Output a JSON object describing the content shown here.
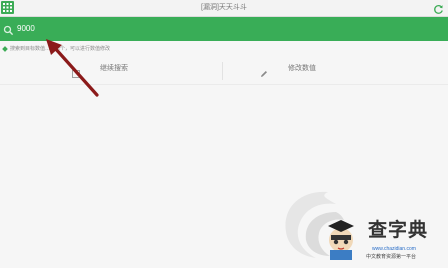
{
  "window": {
    "title": "[漏洞]天天斗斗"
  },
  "search": {
    "value": "9000"
  },
  "hint": {
    "text": "搜索到目标数值…目标个，可以进行数值修改"
  },
  "actions": {
    "continue_label": "继续搜索",
    "modify_label": "修改数值"
  },
  "watermark": {
    "logo_text": "查字典",
    "url": "www.chazidian.com",
    "tagline": "中文教育资源第一平台"
  },
  "colors": {
    "accent": "#39ad57",
    "annotation_arrow": "#8b1a1a"
  },
  "icons": {
    "menu": "grid-icon",
    "refresh": "refresh-icon",
    "search": "search-icon",
    "continue": "checkbox-icon",
    "modify": "pencil-icon"
  }
}
